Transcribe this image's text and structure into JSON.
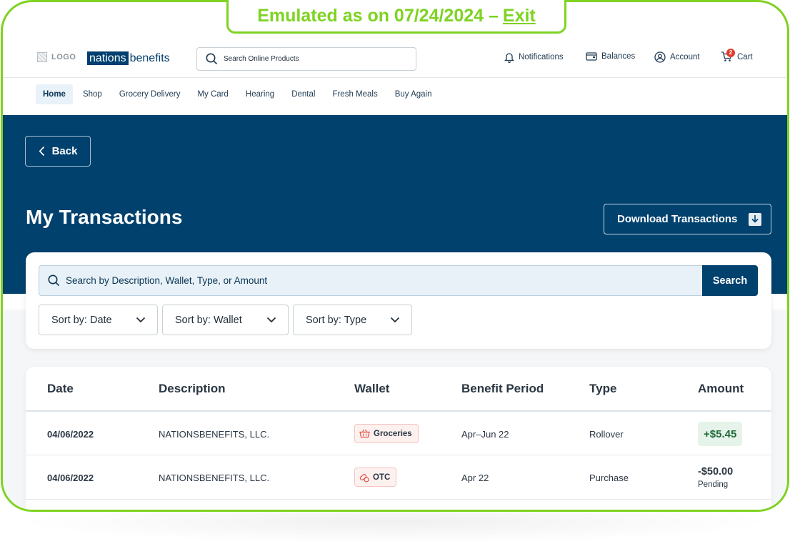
{
  "banner": {
    "text": "Emulated as on 07/24/2024 –",
    "exit_label": "Exit"
  },
  "header": {
    "logo_placeholder": "LOGO",
    "brand_part1": "nations",
    "brand_part2": "benefits",
    "search_placeholder": "Search Online Products",
    "notifications_label": "Notifications",
    "balances_label": "Balances",
    "account_label": "Account",
    "cart_label": "Cart",
    "cart_count": "2"
  },
  "subnav": {
    "items": [
      "Home",
      "Shop",
      "Grocery Delivery",
      "My Card",
      "Hearing",
      "Dental",
      "Fresh Meals",
      "Buy Again"
    ],
    "active": "Home"
  },
  "hero": {
    "back_label": "Back",
    "title": "My Transactions",
    "download_label": "Download Transactions"
  },
  "search": {
    "placeholder": "Search by Description, Wallet, Type, or Amount",
    "button_label": "Search",
    "sort_date": "Sort by: Date",
    "sort_wallet": "Sort by: Wallet",
    "sort_type": "Sort by: Type"
  },
  "table": {
    "headers": [
      "Date",
      "Description",
      "Wallet",
      "Benefit Period",
      "Type",
      "Amount"
    ],
    "rows": [
      {
        "date": "04/06/2022",
        "description": "NATIONSBENEFITS, LLC.",
        "wallet": "Groceries",
        "period": "Apr–Jun 22",
        "type": "Rollover",
        "amount": "+$5.45",
        "status": ""
      },
      {
        "date": "04/06/2022",
        "description": "NATIONSBENEFITS, LLC.",
        "wallet": "OTC",
        "period": "Apr 22",
        "type": "Purchase",
        "amount": "-$50.00",
        "status": "Pending"
      }
    ]
  },
  "colors": {
    "brand": "#00416e",
    "emulation_accent": "#7ed321",
    "positive": "#1f6b3a",
    "badge": "#e03b2e"
  },
  "icons": [
    "search-icon",
    "bell-icon",
    "wallet-icon",
    "account-icon",
    "cart-icon",
    "chevron-left-icon",
    "download-icon",
    "chevron-down-icon",
    "basket-icon",
    "pills-icon"
  ]
}
